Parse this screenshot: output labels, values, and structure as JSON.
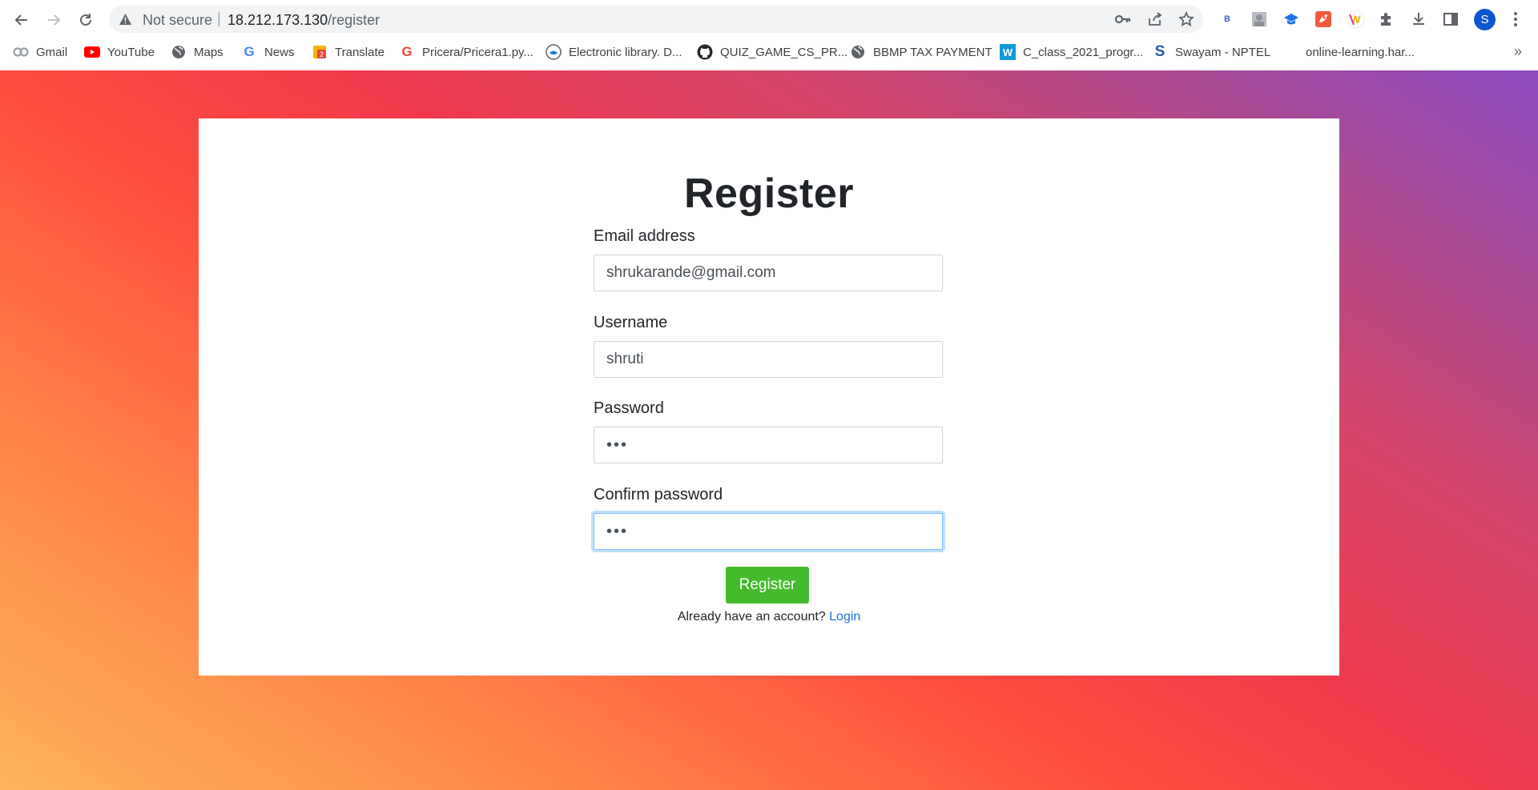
{
  "browser": {
    "security_label": "Not secure",
    "url_separator": "|",
    "url_host": "18.212.173.130",
    "url_path": "/register",
    "profile_initial": "S",
    "extensions": [
      "B",
      "avatar-photo",
      "graduation-cap",
      "rocket",
      "W",
      "puzzle",
      "download",
      "side-panel"
    ],
    "bookmarks": [
      {
        "label": "Gmail",
        "icon": "gmail-icon"
      },
      {
        "label": "YouTube",
        "icon": "youtube-icon"
      },
      {
        "label": "Maps",
        "icon": "globe-icon"
      },
      {
        "label": "News",
        "icon": "google-icon"
      },
      {
        "label": "Translate",
        "icon": "translate-icon"
      },
      {
        "label": "Pricera/Pricera1.py...",
        "icon": "google-icon"
      },
      {
        "label": "Electronic library. D...",
        "icon": "library-icon"
      },
      {
        "label": "QUIZ_GAME_CS_PR...",
        "icon": "github-icon"
      },
      {
        "label": "BBMP TAX PAYMENT",
        "icon": "globe-icon"
      },
      {
        "label": "C_class_2021_progr...",
        "icon": "w-icon"
      },
      {
        "label": "Swayam - NPTEL",
        "icon": "swayam-icon"
      },
      {
        "label": "online-learning.har...",
        "icon": "none"
      }
    ],
    "bookmarks_overflow": "»"
  },
  "form": {
    "title": "Register",
    "email_label": "Email address",
    "email_value": "shrukarande@gmail.com",
    "username_label": "Username",
    "username_value": "shruti",
    "password_label": "Password",
    "password_value": "•••",
    "confirm_label": "Confirm password",
    "confirm_value": "•••",
    "submit_label": "Register",
    "footer_text": "Already have an account?",
    "login_link": "Login"
  },
  "colors": {
    "submit_button": "#44bb2c",
    "login_link": "#1f6fd9",
    "gradient": [
      "#fdb35a",
      "#ff4d3f",
      "#8a4abf"
    ]
  }
}
